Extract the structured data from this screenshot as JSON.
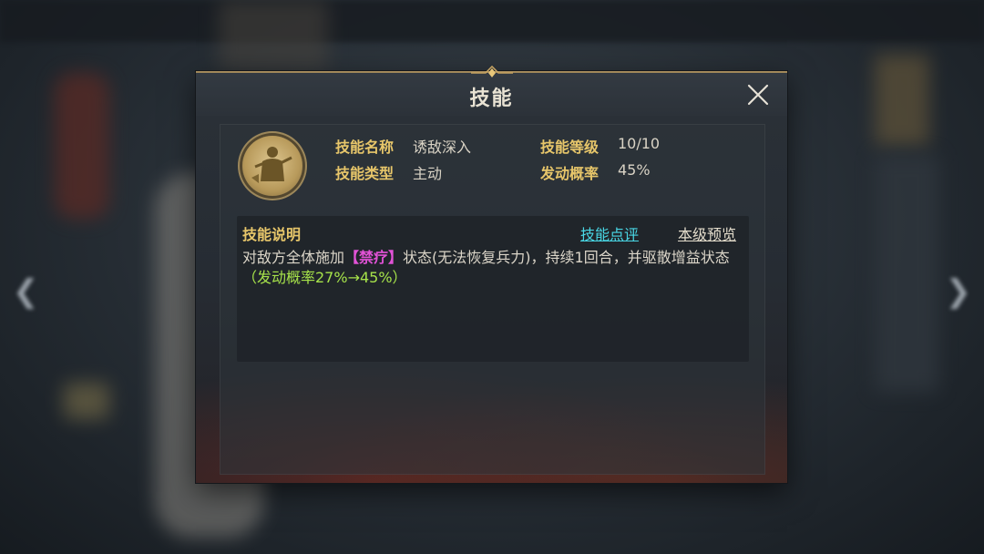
{
  "dialog": {
    "title": "技能"
  },
  "skill": {
    "name_label": "技能名称",
    "name_value": "诱敌深入",
    "type_label": "技能类型",
    "type_value": "主动",
    "level_label": "技能等级",
    "level_value": "10/10",
    "rate_label": "发动概率",
    "rate_value": "45%"
  },
  "description": {
    "header": "技能说明",
    "review_link": "技能点评",
    "preview_link": "本级预览",
    "text_prefix": "对敌方全体施加",
    "keyword": "【禁疗】",
    "text_middle": "状态(无法恢复兵力)，持续1回合，并驱散增益状态",
    "green_note": "（发动概率27%→45%）"
  },
  "icons": {
    "close": "close-icon",
    "avatar": "skill-portrait-icon"
  },
  "colors": {
    "label": "#e7c66a",
    "link_review": "#49d8e6",
    "keyword": "#e152d6",
    "note": "#a6e24a"
  }
}
